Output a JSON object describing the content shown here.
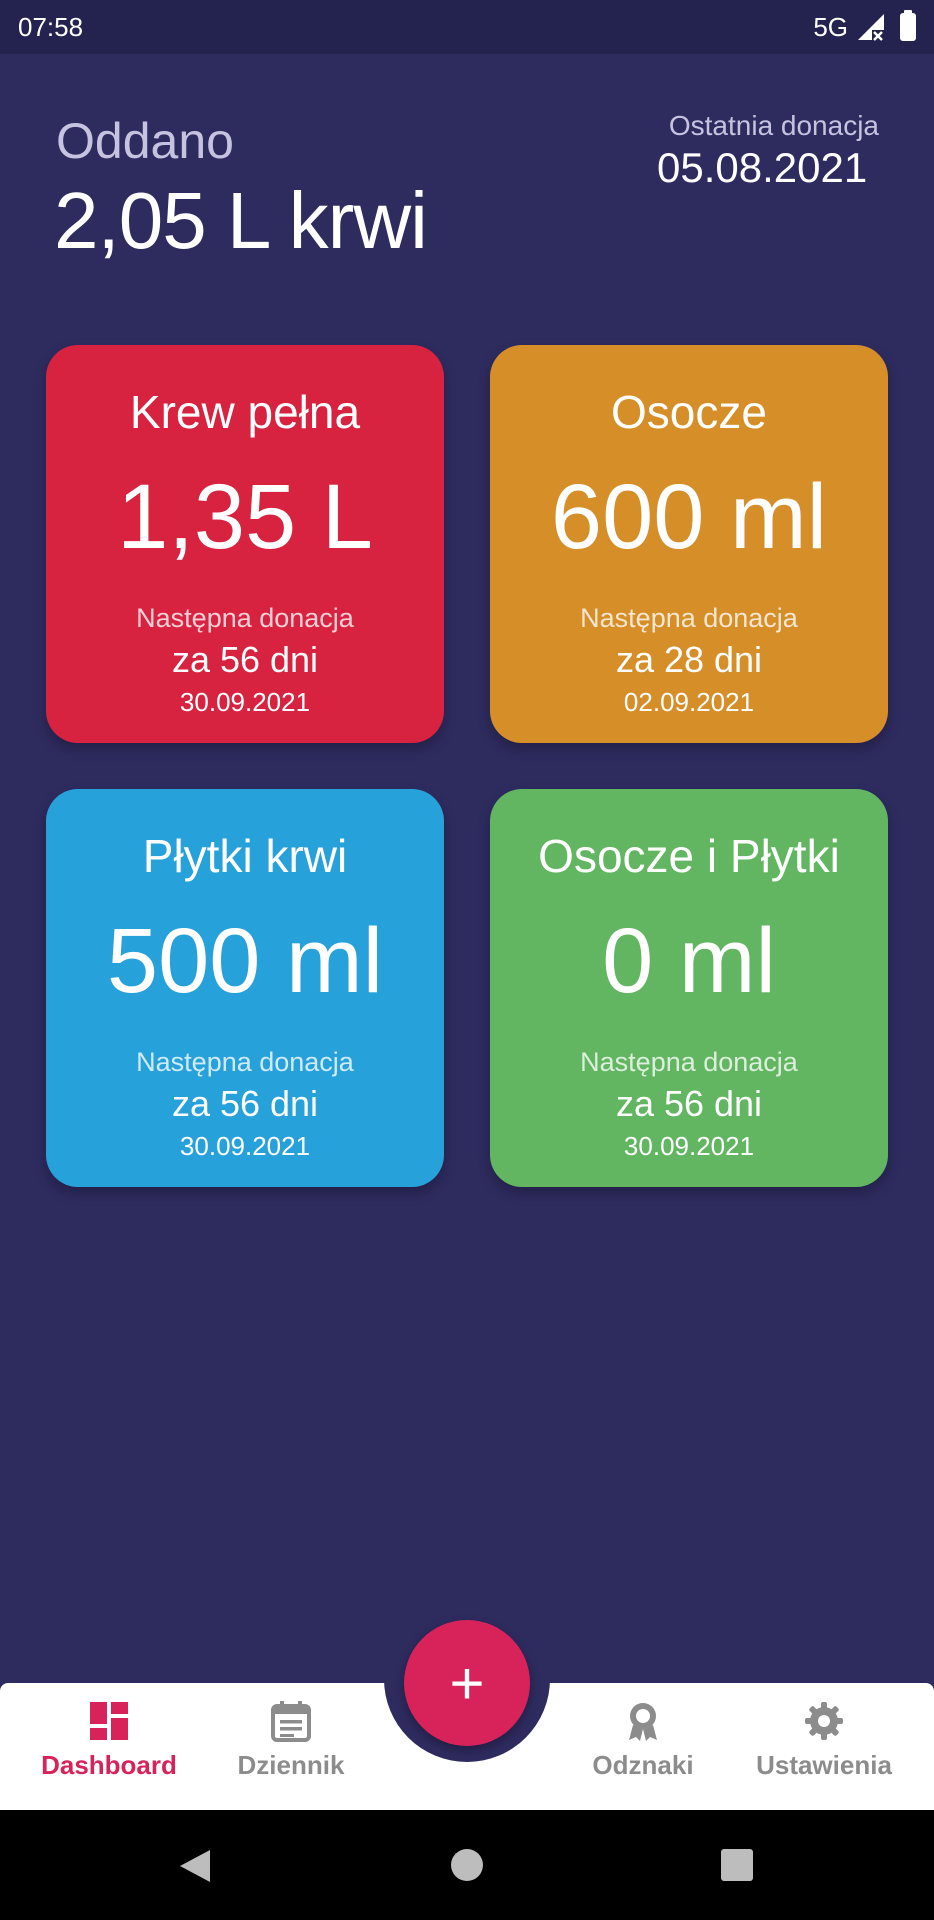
{
  "status_bar": {
    "time": "07:58",
    "network": "5G"
  },
  "summary": {
    "label": "Oddano",
    "value": "2,05 L krwi",
    "last_donation_label": "Ostatnia donacja",
    "last_donation_date": "05.08.2021"
  },
  "cards": [
    {
      "title": "Krew pełna",
      "amount": "1,35 L",
      "next_label": "Następna donacja",
      "days": "za 56 dni",
      "date": "30.09.2021",
      "color": "#d72340"
    },
    {
      "title": "Osocze",
      "amount": "600 ml",
      "next_label": "Następna donacja",
      "days": "za 28 dni",
      "date": "02.09.2021",
      "color": "#d68e28"
    },
    {
      "title": "Płytki krwi",
      "amount": "500 ml",
      "next_label": "Następna donacja",
      "days": "za 56 dni",
      "date": "30.09.2021",
      "color": "#27a1d9"
    },
    {
      "title": "Osocze i Płytki",
      "amount": "0 ml",
      "next_label": "Następna donacja",
      "days": "za 56 dni",
      "date": "30.09.2021",
      "color": "#62b561"
    }
  ],
  "fab": {
    "label": "+",
    "icon": "plus-icon"
  },
  "bottom_nav": {
    "items": [
      {
        "label": "Dashboard",
        "icon": "dashboard-icon",
        "active": true
      },
      {
        "label": "Dziennik",
        "icon": "calendar-icon",
        "active": false
      },
      {
        "label": "Odznaki",
        "icon": "badge-icon",
        "active": false
      },
      {
        "label": "Ustawienia",
        "icon": "gear-icon",
        "active": false
      }
    ]
  },
  "colors": {
    "background": "#2e2b5f",
    "accent": "#d8235a",
    "inactive": "#8c8c8c"
  }
}
